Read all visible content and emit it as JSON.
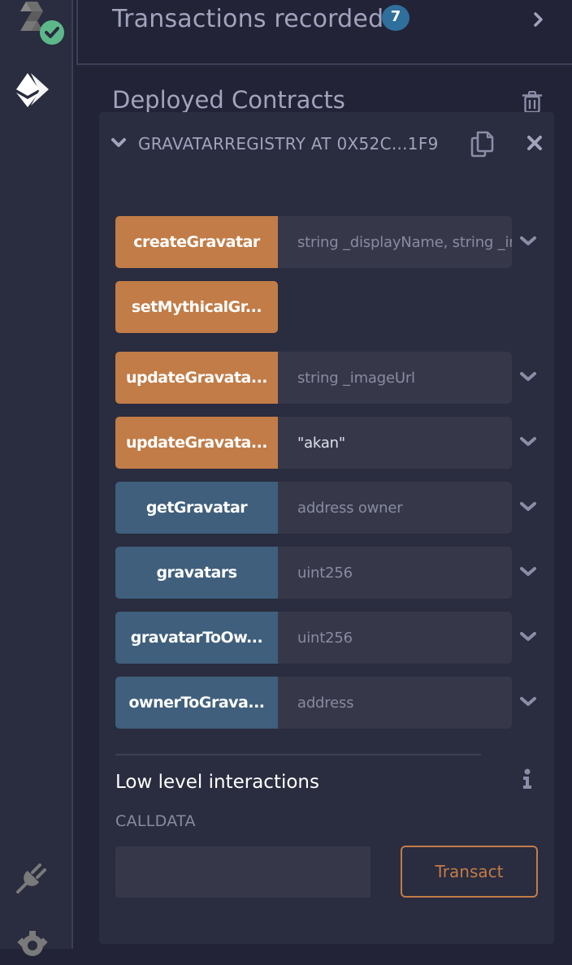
{
  "iconbar": {
    "top_icons": [
      "solidity-compiler-icon",
      "deploy-run-icon"
    ],
    "compiler_status": "success",
    "bottom_icons": [
      "plugin-manager-icon",
      "settings-icon"
    ]
  },
  "transactions": {
    "title": "Transactions recorded",
    "count": "7"
  },
  "deployed": {
    "title": "Deployed Contracts"
  },
  "contract": {
    "title": "GRAVATARREGISTRY AT 0X52C...1F9",
    "functions": [
      {
        "label": "createGravatar",
        "kind": "transact",
        "placeholder": "string _displayName, string _imageUrl",
        "value": "",
        "has_input": true
      },
      {
        "label": "setMythicalGr...",
        "kind": "transact",
        "placeholder": "",
        "value": "",
        "has_input": false
      },
      {
        "label": "updateGravata...",
        "kind": "transact",
        "placeholder": "string _imageUrl",
        "value": "",
        "has_input": true
      },
      {
        "label": "updateGravata...",
        "kind": "transact",
        "placeholder": "",
        "value": "\"akan\"",
        "has_input": true
      },
      {
        "label": "getGravatar",
        "kind": "call",
        "placeholder": "address owner",
        "value": "",
        "has_input": true
      },
      {
        "label": "gravatars",
        "kind": "call",
        "placeholder": "uint256",
        "value": "",
        "has_input": true
      },
      {
        "label": "gravatarToOw...",
        "kind": "call",
        "placeholder": "uint256",
        "value": "",
        "has_input": true
      },
      {
        "label": "ownerToGrava...",
        "kind": "call",
        "placeholder": "address",
        "value": "",
        "has_input": true
      }
    ]
  },
  "low_level": {
    "title": "Low level interactions",
    "calldata_label": "CALLDATA",
    "calldata_value": "",
    "transact_label": "Transact"
  },
  "colors": {
    "transact": "#c17c47",
    "call": "#3f5f7c",
    "badge": "#2f6f9c",
    "success": "#5cb88a"
  }
}
